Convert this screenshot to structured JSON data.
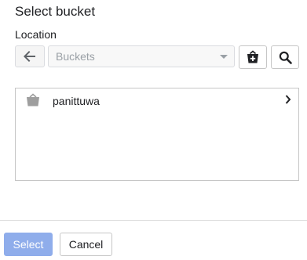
{
  "dialog": {
    "title": "Select bucket"
  },
  "location": {
    "label": "Location",
    "select_value": "Buckets"
  },
  "toolbar": {
    "back_icon": "arrow-left-icon",
    "new_bucket_icon": "new-bucket-icon",
    "search_icon": "search-icon"
  },
  "buckets": [
    {
      "name": "panittuwa",
      "icon": "bucket-icon",
      "chevron": "chevron-right-icon"
    }
  ],
  "footer": {
    "select_label": "Select",
    "cancel_label": "Cancel"
  },
  "colors": {
    "select_button_bg": "#8fadeb",
    "border": "#c6c6c6",
    "icon": "#202124",
    "muted_icon": "#9e9e9e"
  }
}
